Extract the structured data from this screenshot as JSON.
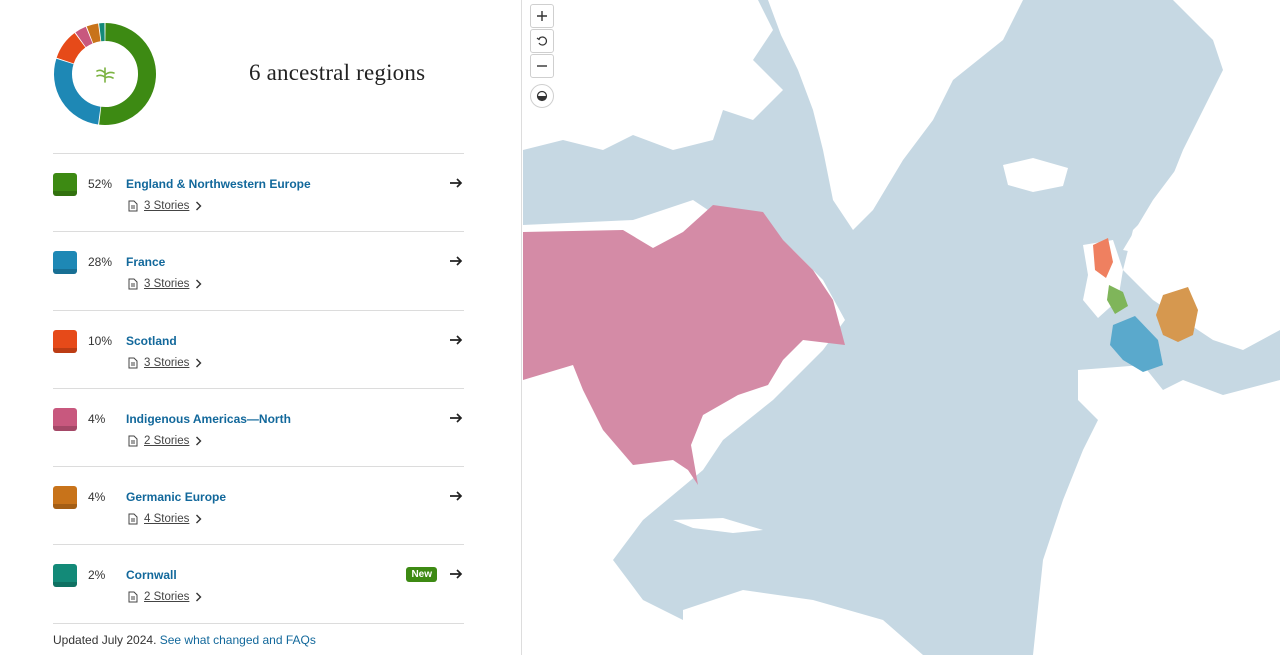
{
  "summary": {
    "heading": "6 ancestral regions"
  },
  "regions": [
    {
      "percent": "52%",
      "name": "England & Northwestern Europe",
      "stories": "3 Stories",
      "color": "#3d8a13",
      "value": 52
    },
    {
      "percent": "28%",
      "name": "France",
      "stories": "3 Stories",
      "color": "#1e88b5",
      "value": 28
    },
    {
      "percent": "10%",
      "name": "Scotland",
      "stories": "3 Stories",
      "color": "#e64a19",
      "value": 10
    },
    {
      "percent": "4%",
      "name": "Indigenous Americas—North",
      "stories": "2 Stories",
      "color": "#c8587e",
      "value": 4
    },
    {
      "percent": "4%",
      "name": "Germanic Europe",
      "stories": "4 Stories",
      "color": "#c8731a",
      "value": 4
    },
    {
      "percent": "2%",
      "name": "Cornwall",
      "stories": "2 Stories",
      "color": "#138a78",
      "value": 2,
      "badge": "New"
    }
  ],
  "footer": {
    "updated": "Updated July 2024.",
    "link": "See what changed and FAQs"
  },
  "map_controls": [
    "zoom-in",
    "reset",
    "zoom-out",
    "contrast"
  ],
  "map_colors": {
    "ocean": "#c6d8e3",
    "land": "#ffffff",
    "north_america_region": "#d48ba6",
    "scotland_region": "#ef8060",
    "england_region": "#7fb55a",
    "france_region": "#5aa9cc",
    "germanic_region": "#d6984f"
  }
}
